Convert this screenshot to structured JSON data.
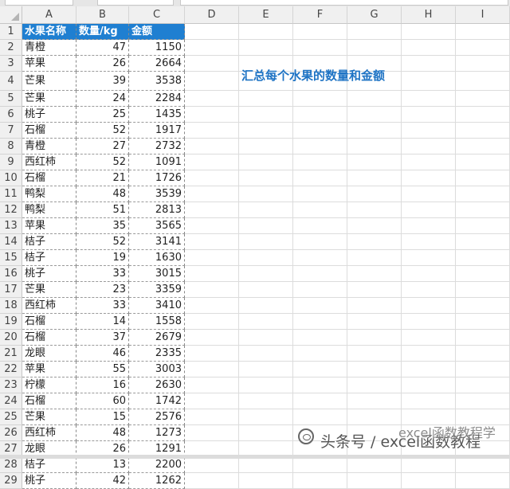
{
  "columns": [
    "A",
    "B",
    "C",
    "D",
    "E",
    "F",
    "G",
    "H",
    "I"
  ],
  "header": {
    "fruit": "水果名称",
    "qty": "数量/kg",
    "amount": "金额"
  },
  "rows": [
    {
      "fruit": "青橙",
      "qty": "47",
      "amount": "1150"
    },
    {
      "fruit": "苹果",
      "qty": "26",
      "amount": "2664"
    },
    {
      "fruit": "芒果",
      "qty": "39",
      "amount": "3538"
    },
    {
      "fruit": "芒果",
      "qty": "24",
      "amount": "2284"
    },
    {
      "fruit": "桃子",
      "qty": "25",
      "amount": "1435"
    },
    {
      "fruit": "石榴",
      "qty": "52",
      "amount": "1917"
    },
    {
      "fruit": "青橙",
      "qty": "27",
      "amount": "2732"
    },
    {
      "fruit": "西红柿",
      "qty": "52",
      "amount": "1091"
    },
    {
      "fruit": "石榴",
      "qty": "21",
      "amount": "1726"
    },
    {
      "fruit": "鸭梨",
      "qty": "48",
      "amount": "3539"
    },
    {
      "fruit": "鸭梨",
      "qty": "51",
      "amount": "2813"
    },
    {
      "fruit": "苹果",
      "qty": "35",
      "amount": "3565"
    },
    {
      "fruit": "桔子",
      "qty": "52",
      "amount": "3141"
    },
    {
      "fruit": "桔子",
      "qty": "19",
      "amount": "1630"
    },
    {
      "fruit": "桃子",
      "qty": "33",
      "amount": "3015"
    },
    {
      "fruit": "芒果",
      "qty": "23",
      "amount": "3359"
    },
    {
      "fruit": "西红柿",
      "qty": "33",
      "amount": "3410"
    },
    {
      "fruit": "石榴",
      "qty": "14",
      "amount": "1558"
    },
    {
      "fruit": "石榴",
      "qty": "37",
      "amount": "2679"
    },
    {
      "fruit": "龙眼",
      "qty": "46",
      "amount": "2335"
    },
    {
      "fruit": "苹果",
      "qty": "55",
      "amount": "3003"
    },
    {
      "fruit": "柠檬",
      "qty": "16",
      "amount": "2630"
    },
    {
      "fruit": "石榴",
      "qty": "60",
      "amount": "1742"
    },
    {
      "fruit": "芒果",
      "qty": "15",
      "amount": "2576"
    },
    {
      "fruit": "西红柿",
      "qty": "48",
      "amount": "1273"
    },
    {
      "fruit": "龙眼",
      "qty": "26",
      "amount": "1291"
    },
    {
      "fruit": "桔子",
      "qty": "13",
      "amount": "2200"
    },
    {
      "fruit": "桃子",
      "qty": "42",
      "amount": "1262"
    }
  ],
  "note": "汇总每个水果的数量和金额",
  "watermark": {
    "main": "头条号 / excel函数教程",
    "overlay": "excel函数教程学"
  },
  "colors": {
    "header_bg": "#1f7fd1",
    "note_text": "#1e73c4"
  }
}
